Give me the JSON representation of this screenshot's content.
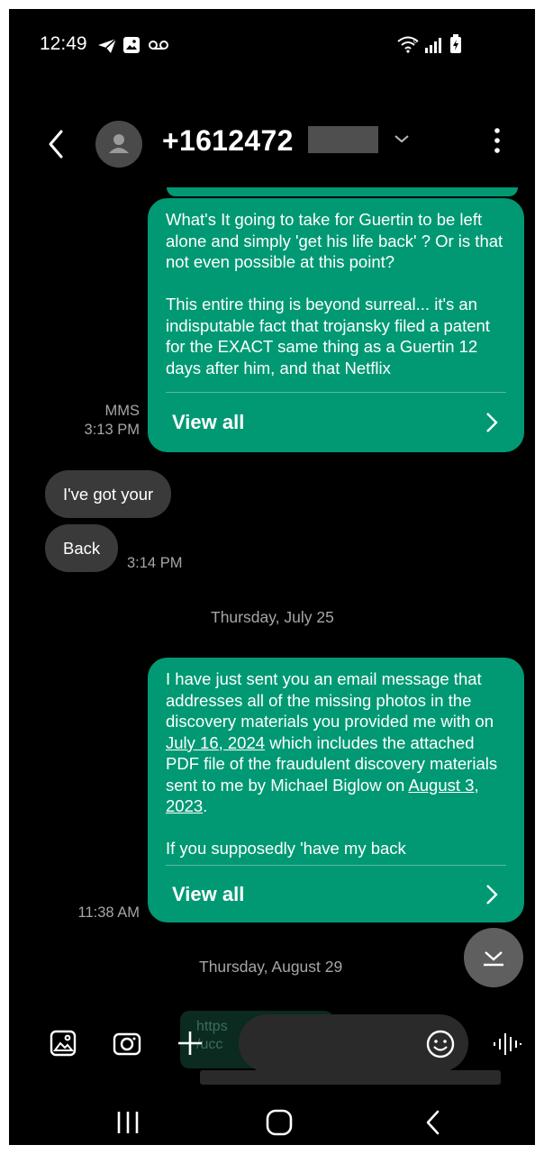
{
  "status_bar": {
    "time": "12:49",
    "icons": [
      "telegram-icon",
      "gallery-icon",
      "voicemail-icon",
      "wifi-icon",
      "signal-icon",
      "battery-charging-icon"
    ]
  },
  "header": {
    "contact_number": "+1612472",
    "redacted": true,
    "icons": [
      "back-arrow-icon",
      "contact-avatar-icon",
      "chevron-down-icon",
      "more-options-icon"
    ]
  },
  "messages": [
    {
      "direction": "outgoing",
      "type": "MMS",
      "text": "What's It going to take for Guertin to be left alone and simply 'get his life back' ? Or is that not even possible at this point?\n\nThis entire thing is beyond surreal... it's an indisputable fact that trojansky filed a patent for the EXACT same thing as a Guertin 12 days after him, and that Netflix",
      "view_all_label": "View all",
      "meta_type": "MMS",
      "time": "3:13 PM"
    },
    {
      "direction": "incoming",
      "text": "I've got your"
    },
    {
      "direction": "incoming",
      "text": "Back",
      "time": "3:14 PM"
    },
    {
      "direction": "date",
      "text": "Thursday, July 25"
    },
    {
      "direction": "outgoing",
      "text_parts": [
        "I have just sent you an email message that addresses all of the missing photos in the discovery materials you provided me with on ",
        "July 16, 2024",
        " which includes the attached PDF file of the fraudulent discovery materials sent to me by Michael Biglow on ",
        "August 3, 2023",
        ".\n\nIf you supposedly 'have my back"
      ],
      "view_all_label": "View all",
      "time": "11:38 AM"
    },
    {
      "direction": "date",
      "text": "Thursday, August 29"
    }
  ],
  "partial_preview_text": "https\n/ucc",
  "composer": {
    "icons": [
      "gallery-icon",
      "camera-icon",
      "plus-icon",
      "emoji-icon",
      "voice-recorder-icon"
    ]
  },
  "nav_bar": {
    "icons": [
      "recent-apps-icon",
      "home-icon",
      "back-icon"
    ]
  },
  "colors": {
    "background": "#000000",
    "outgoing_bubble": "#009973",
    "incoming_bubble": "#3a3a3a",
    "meta_text": "#a6a6a6"
  }
}
